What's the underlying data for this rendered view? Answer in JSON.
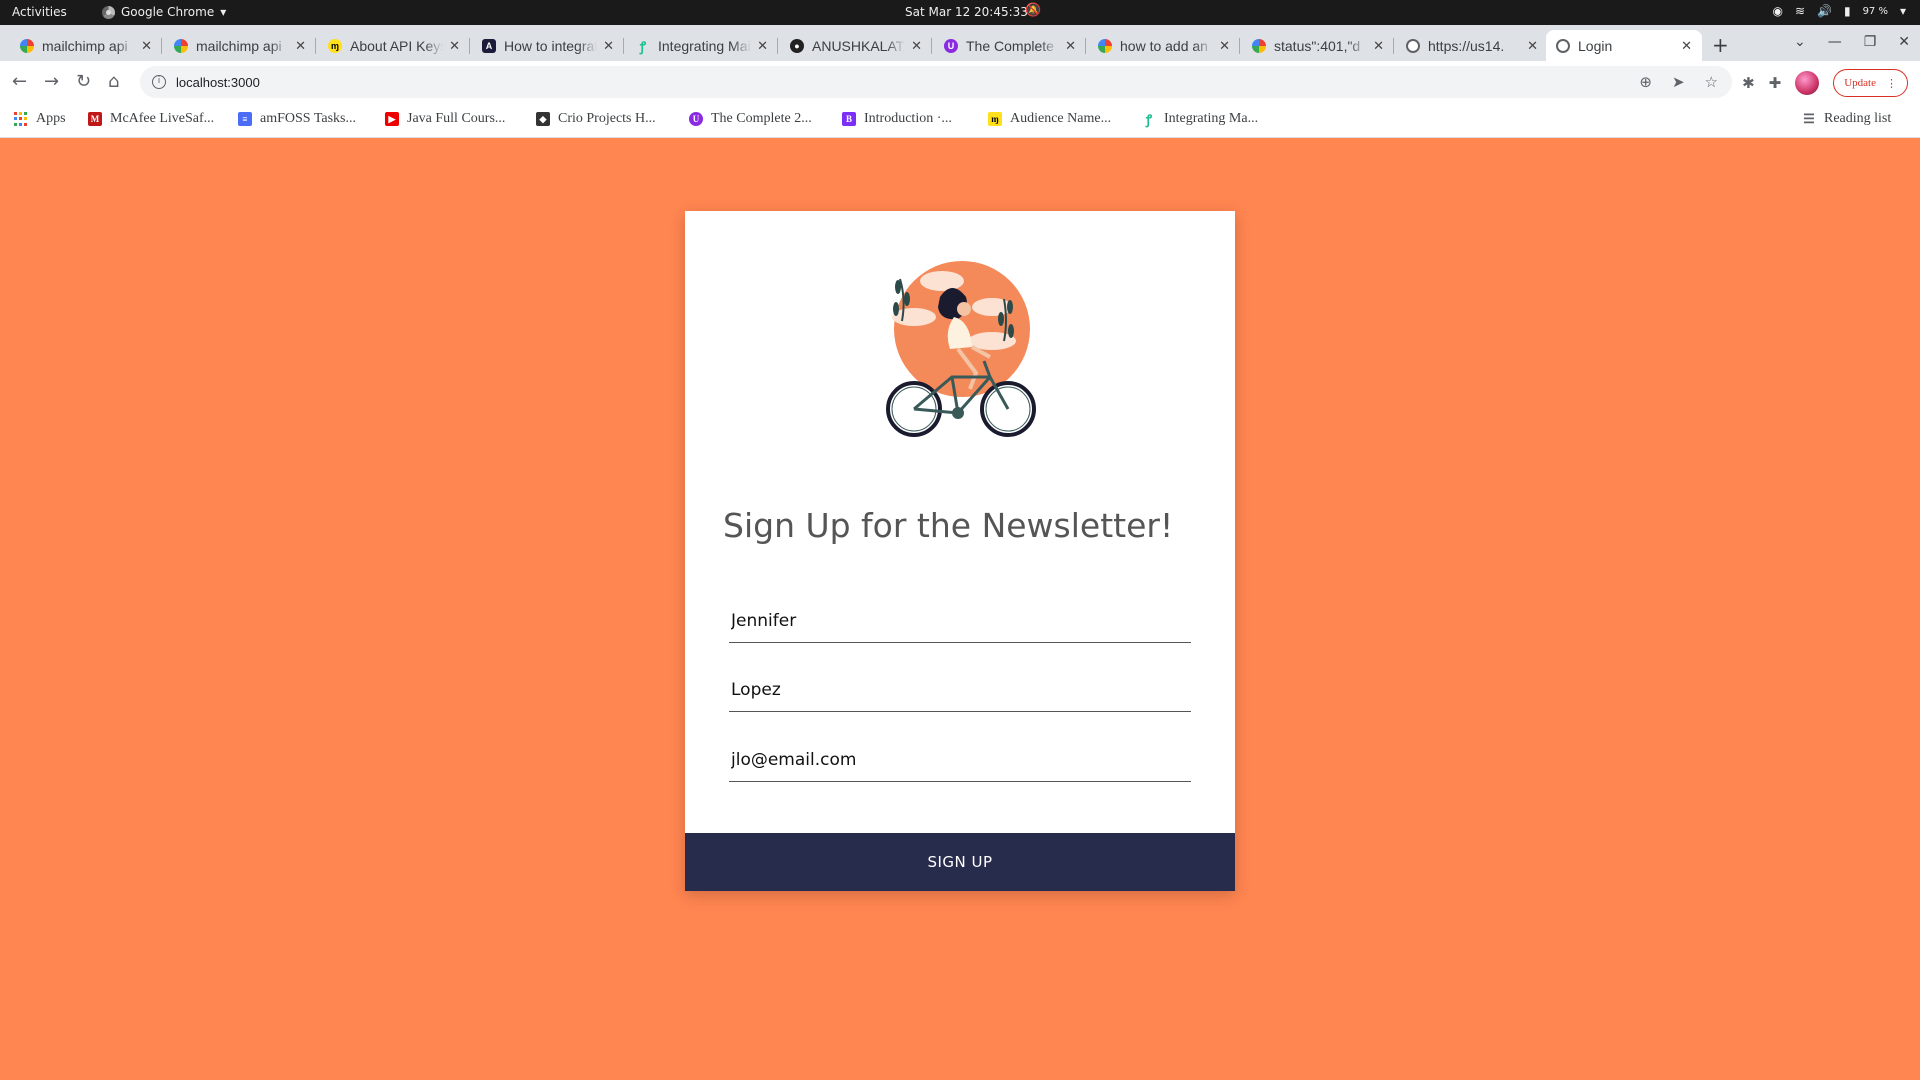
{
  "system_bar": {
    "activities": "Activities",
    "app_name": "Google Chrome",
    "clock": "Sat Mar 12  20:45:33",
    "battery": "97 %"
  },
  "tabs": [
    {
      "label": "mailchimp api",
      "icon": "google-icon"
    },
    {
      "label": "mailchimp api",
      "icon": "google-icon"
    },
    {
      "label": "About API Keys",
      "icon": "mailchimp-icon"
    },
    {
      "label": "How to integrate",
      "icon": "dark-square-icon"
    },
    {
      "label": "Integrating Mailchimp",
      "icon": "green-logo-icon"
    },
    {
      "label": "ANUSHKALATA",
      "icon": "github-icon"
    },
    {
      "label": "The Complete",
      "icon": "udemy-icon"
    },
    {
      "label": "how to add an",
      "icon": "google-icon"
    },
    {
      "label": "status\":401,\"d",
      "icon": "google-icon"
    },
    {
      "label": "https://us14.",
      "icon": "globe-icon"
    },
    {
      "label": "Login",
      "icon": "globe-icon",
      "active": true
    }
  ],
  "toolbar": {
    "url": "localhost:3000",
    "update_label": "Update"
  },
  "bookmarks": {
    "apps": "Apps",
    "items": [
      "McAfee LiveSaf...",
      "amFOSS Tasks...",
      "Java Full Cours...",
      "Crio Projects H...",
      "The Complete 2...",
      "Introduction ·...",
      "Audience Name...",
      "Integrating Ma..."
    ],
    "reading_list": "Reading list"
  },
  "form": {
    "heading": "Sign Up for the Newsletter!",
    "first_name": "Jennifer",
    "last_name": "Lopez",
    "email": "jlo@email.com",
    "submit_label": "SIGN UP"
  },
  "colors": {
    "page_background": "#ff8551",
    "button_background": "#272c4d",
    "card_background": "#ffffff"
  }
}
